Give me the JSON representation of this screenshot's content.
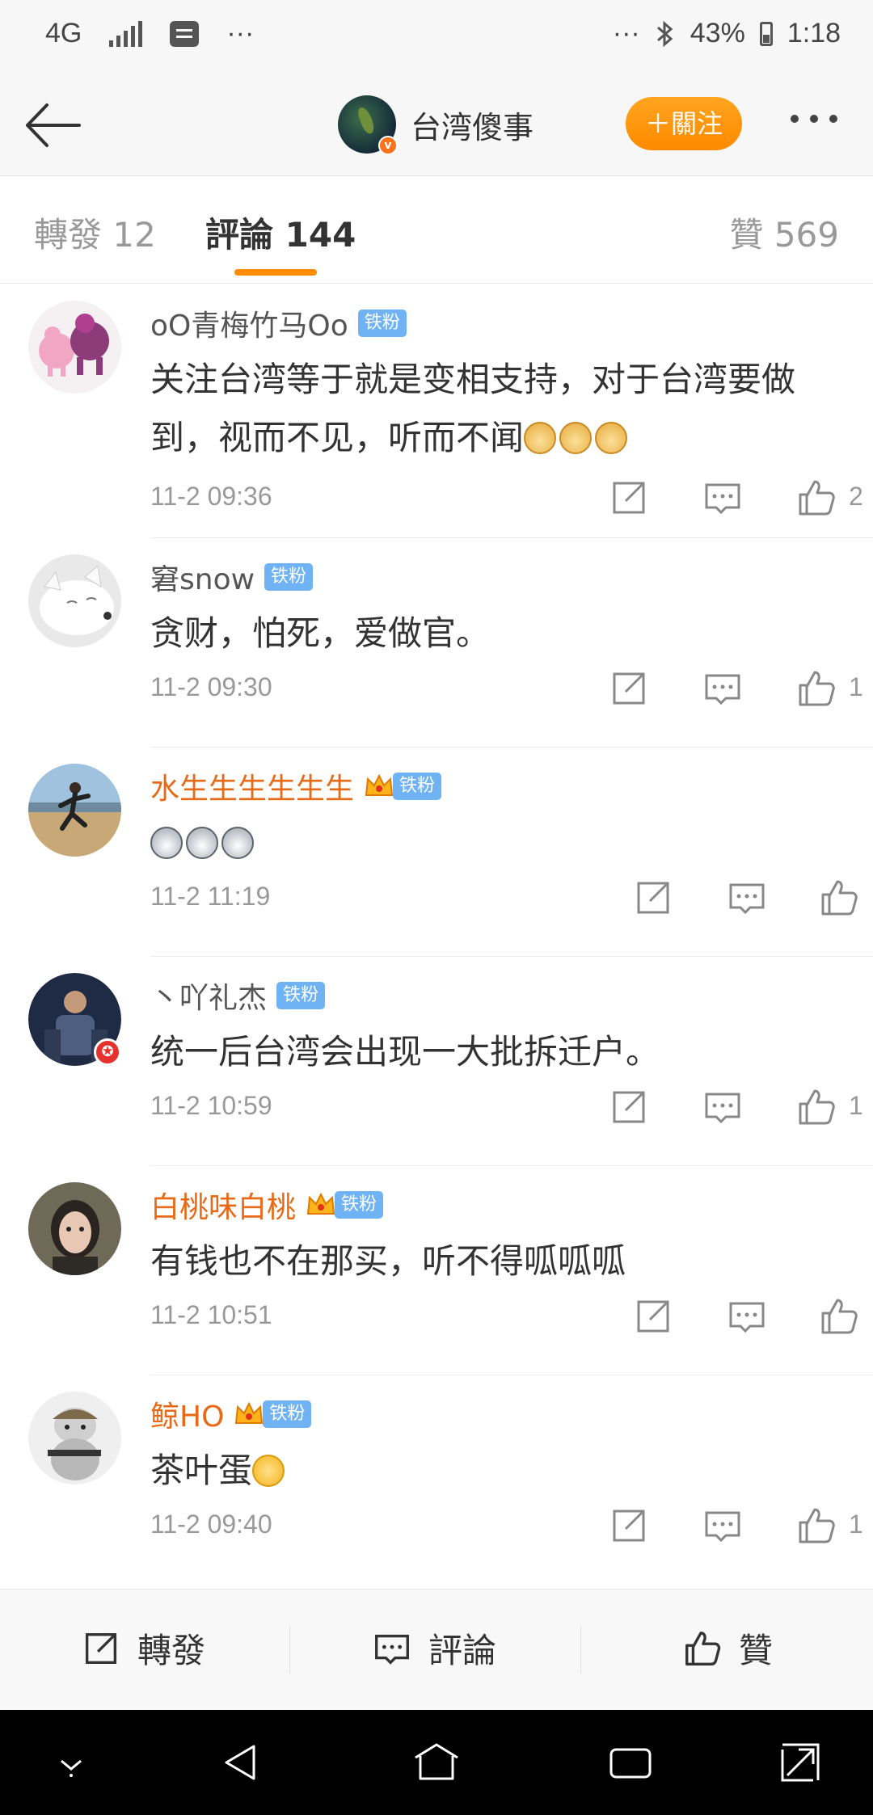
{
  "status_bar": {
    "network": "4G",
    "left_dots": "···",
    "right_dots": "···",
    "battery": "43%",
    "time": "1:18"
  },
  "header": {
    "title": "台湾傻事",
    "follow_label": "＋關注"
  },
  "tabs": [
    {
      "label": "轉發 12",
      "active": false
    },
    {
      "label": "評論 144",
      "active": true
    },
    {
      "label": "贊 569",
      "active": false
    }
  ],
  "fan_badge": "铁粉",
  "comments": [
    {
      "user": "oO青梅竹马Oo",
      "vip": false,
      "text": "关注台湾等于就是变相支持，对于台湾要做到，视而不见，听而不闻",
      "emoji": [
        "doge",
        "doge",
        "doge"
      ],
      "time": "11-2 09:36",
      "likes": "2"
    },
    {
      "user": "窘snow",
      "vip": false,
      "text": "贪财，怕死，爱做官。",
      "emoji": [],
      "time": "11-2 09:30",
      "likes": "1"
    },
    {
      "user": "水生生生生生生",
      "vip": true,
      "text": "",
      "emoji": [
        "husky",
        "husky",
        "husky"
      ],
      "time": "11-2 11:19",
      "likes": ""
    },
    {
      "user": "丶吖礼杰",
      "vip": false,
      "text": "统一后台湾会出现一大批拆迁户。",
      "emoji": [],
      "time": "11-2 10:59",
      "likes": "1"
    },
    {
      "user": "白桃味白桃",
      "vip": true,
      "text": "有钱也不在那买，听不得呱呱呱",
      "emoji": [],
      "time": "11-2 10:51",
      "likes": ""
    },
    {
      "user": "鲸HO",
      "vip": true,
      "text": "茶叶蛋",
      "emoji": [
        "laugh"
      ],
      "time": "11-2 09:40",
      "likes": "1"
    }
  ],
  "bottom_bar": {
    "repost": "轉發",
    "comment": "評論",
    "like": "贊"
  },
  "colors": {
    "accent": "#ff8c00",
    "vip_name": "#e86a16",
    "badge": "#6fb3f4"
  }
}
